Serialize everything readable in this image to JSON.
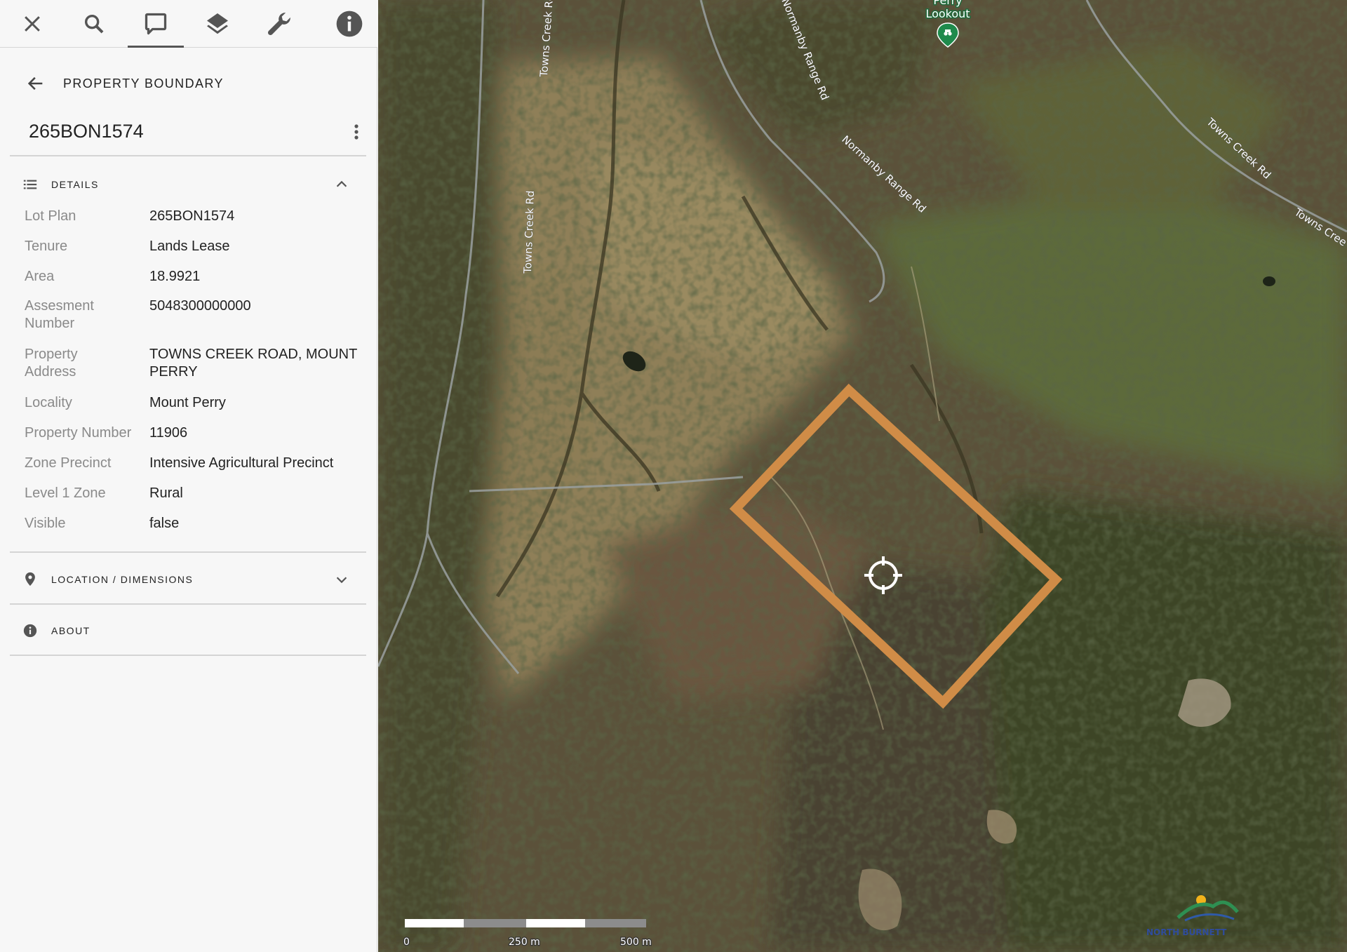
{
  "toolbar": {
    "tools": [
      {
        "name": "close-icon",
        "active": false
      },
      {
        "name": "search-icon",
        "active": false
      },
      {
        "name": "comment-icon",
        "active": true
      },
      {
        "name": "layers-icon",
        "active": false
      },
      {
        "name": "wrench-icon",
        "active": false
      },
      {
        "name": "info-icon",
        "active": false
      }
    ]
  },
  "panel": {
    "back_label": "PROPERTY BOUNDARY",
    "title": "265BON1574",
    "sections": {
      "details": {
        "label": "DETAILS",
        "expanded": true,
        "icon": "list-icon",
        "rows": [
          {
            "key": "Lot Plan",
            "value": "265BON1574"
          },
          {
            "key": "Tenure",
            "value": "Lands Lease"
          },
          {
            "key": "Area",
            "value": "18.9921"
          },
          {
            "key": "Assesment Number",
            "value": "5048300000000"
          },
          {
            "key": "Property Address",
            "value": "TOWNS CREEK ROAD, MOUNT PERRY"
          },
          {
            "key": "Locality",
            "value": "Mount Perry"
          },
          {
            "key": "Property Number",
            "value": "11906"
          },
          {
            "key": "Zone Precinct",
            "value": "Intensive Agricultural Precinct"
          },
          {
            "key": "Level 1 Zone",
            "value": "Rural"
          },
          {
            "key": "Visible",
            "value": "false"
          }
        ]
      },
      "location": {
        "label": "LOCATION / DIMENSIONS",
        "expanded": false,
        "icon": "map-pin-icon"
      },
      "about": {
        "label": "ABOUT",
        "icon": "info-circle-icon"
      }
    }
  },
  "map": {
    "lookout_label_1": "Perry",
    "lookout_label_2": "Lookout",
    "roads": [
      {
        "label": "Towns Creek Rd"
      },
      {
        "label": "Towns Creek Rd"
      },
      {
        "label": "Normanby Range Rd"
      },
      {
        "label": "Normanby Range Rd"
      },
      {
        "label": "Towns Creek Rd"
      },
      {
        "label": "Towns Cree"
      }
    ],
    "scale": {
      "labels": [
        "0",
        "250 m",
        "500 m"
      ]
    },
    "boundary_color": "#d08c47",
    "logo_text": "NORTH BURNETT",
    "accent_colors": {
      "boundary": "#d08c47",
      "lookout_marker": "#1f8a4c"
    }
  }
}
